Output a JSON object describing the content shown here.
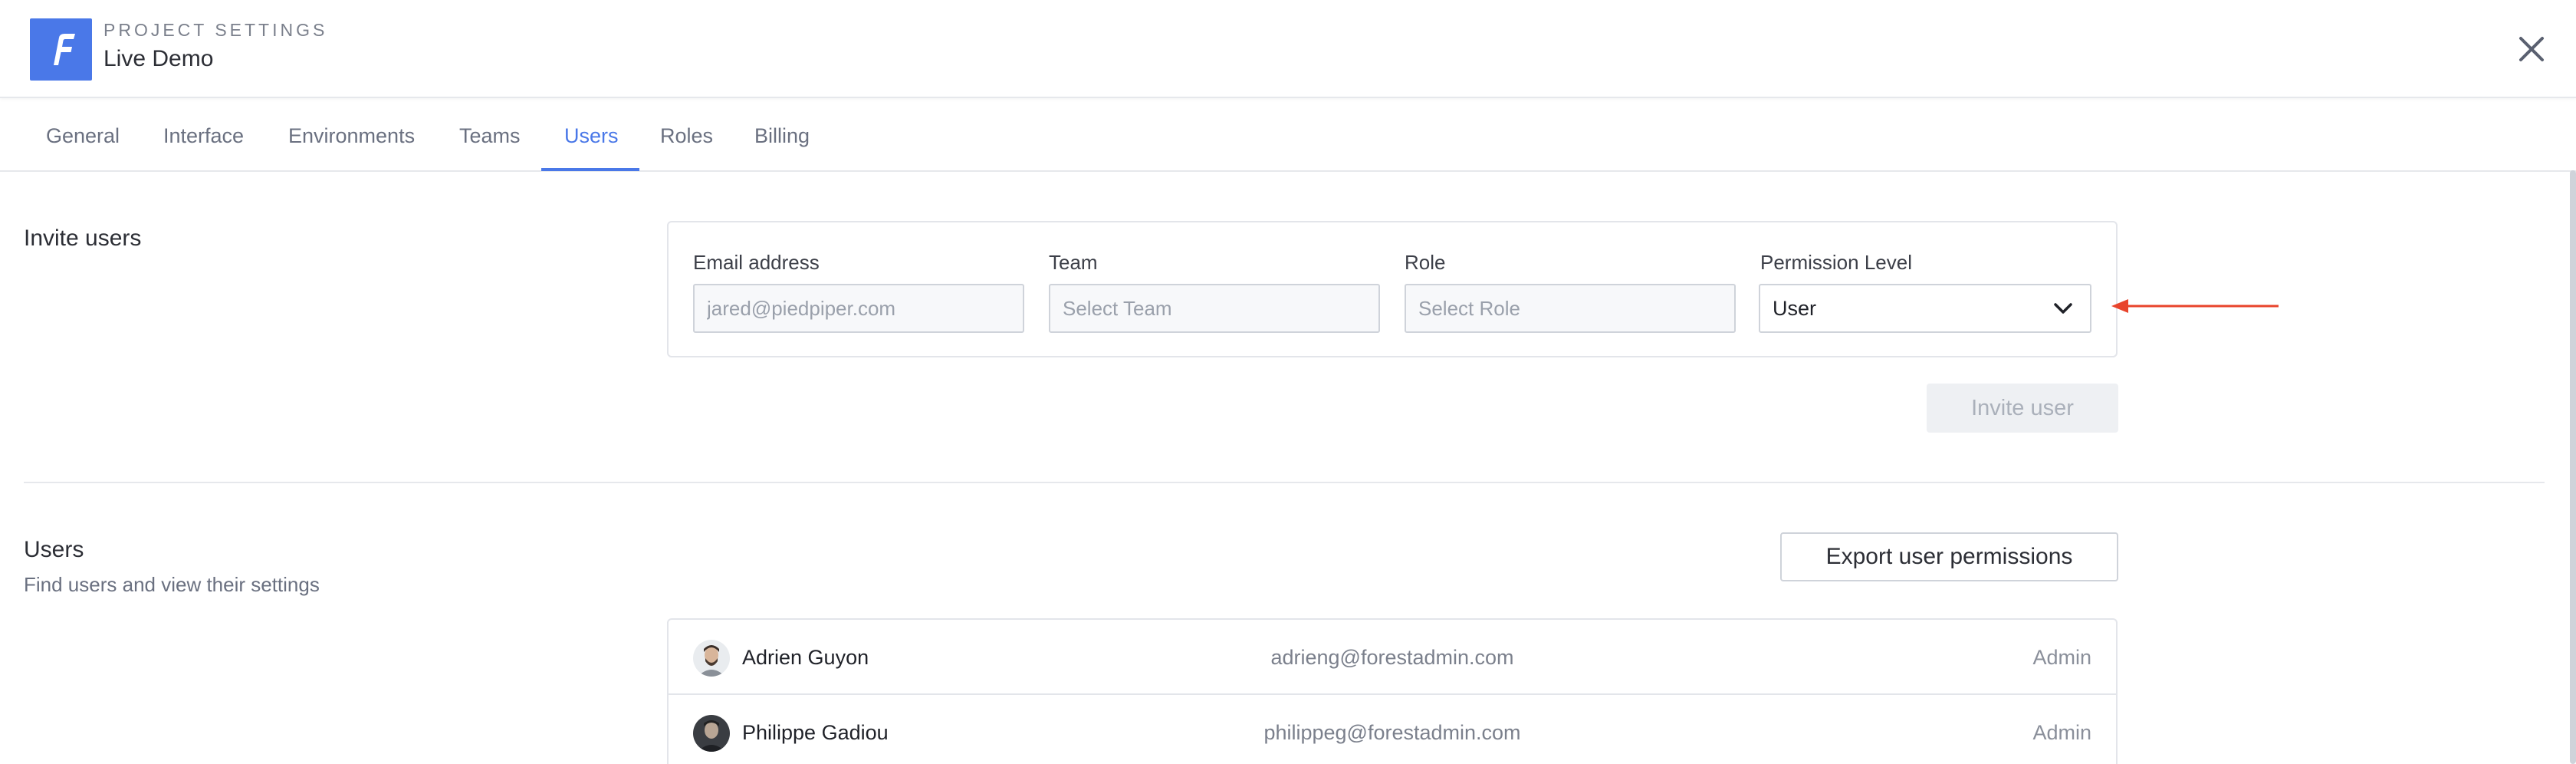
{
  "header": {
    "kicker": "PROJECT SETTINGS",
    "title": "Live Demo",
    "logo_letter": "F",
    "accent_color": "#4a78e8"
  },
  "tabs": [
    {
      "label": "General"
    },
    {
      "label": "Interface"
    },
    {
      "label": "Environments"
    },
    {
      "label": "Teams"
    },
    {
      "label": "Users",
      "active": true
    },
    {
      "label": "Roles"
    },
    {
      "label": "Billing"
    }
  ],
  "invite": {
    "title": "Invite users",
    "email_label": "Email address",
    "email_placeholder": "jared@piedpiper.com",
    "team_label": "Team",
    "team_placeholder": "Select Team",
    "role_label": "Role",
    "role_placeholder": "Select Role",
    "permission_label": "Permission Level",
    "permission_value": "User",
    "invite_button": "Invite user",
    "annotation_color": "#e8442c"
  },
  "users": {
    "title": "Users",
    "subtitle": "Find users and view their settings",
    "export_button": "Export user permissions",
    "rows": [
      {
        "name": "Adrien Guyon",
        "email": "adrieng@forestadmin.com",
        "role": "Admin"
      },
      {
        "name": "Philippe Gadiou",
        "email": "philippeg@forestadmin.com",
        "role": "Admin"
      }
    ]
  }
}
